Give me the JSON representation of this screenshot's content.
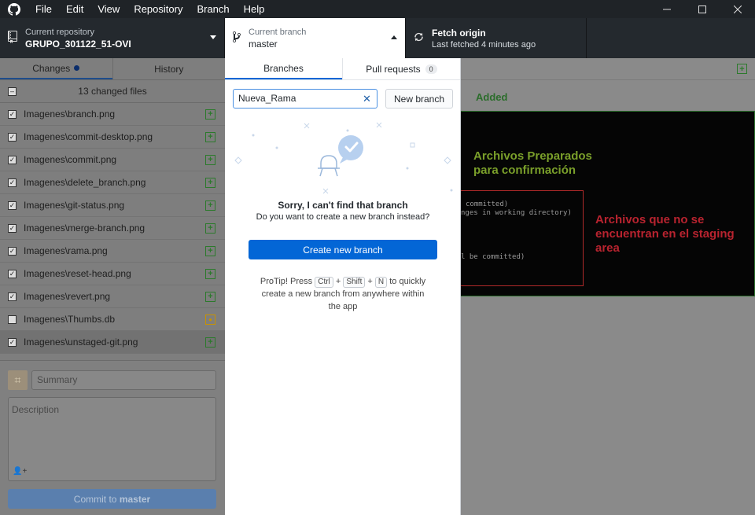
{
  "menu": [
    "File",
    "Edit",
    "View",
    "Repository",
    "Branch",
    "Help"
  ],
  "toolbar": {
    "repo_label": "Current repository",
    "repo_name": "GRUPO_301122_51-OVI",
    "branch_label": "Current branch",
    "branch_name": "master",
    "fetch_title": "Fetch origin",
    "fetch_sub": "Last fetched 4 minutes ago"
  },
  "sidebar": {
    "tab_changes": "Changes",
    "tab_history": "History",
    "changed_count": "13 changed files",
    "files": [
      {
        "name": "Imagenes\\branch.png",
        "checked": true,
        "status": "added"
      },
      {
        "name": "Imagenes\\commit-desktop.png",
        "checked": true,
        "status": "added"
      },
      {
        "name": "Imagenes\\commit.png",
        "checked": true,
        "status": "added"
      },
      {
        "name": "Imagenes\\delete_branch.png",
        "checked": true,
        "status": "added"
      },
      {
        "name": "Imagenes\\git-status.png",
        "checked": true,
        "status": "added"
      },
      {
        "name": "Imagenes\\merge-branch.png",
        "checked": true,
        "status": "added"
      },
      {
        "name": "Imagenes\\rama.png",
        "checked": true,
        "status": "added"
      },
      {
        "name": "Imagenes\\reset-head.png",
        "checked": true,
        "status": "added"
      },
      {
        "name": "Imagenes\\revert.png",
        "checked": true,
        "status": "added"
      },
      {
        "name": "Imagenes\\Thumbs.db",
        "checked": false,
        "status": "modified"
      },
      {
        "name": "Imagenes\\unstaged-git.png",
        "checked": true,
        "status": "added"
      }
    ],
    "summary_placeholder": "Summary",
    "description_placeholder": "Description",
    "commit_prefix": "Commit to ",
    "commit_branch": "master"
  },
  "dropdown": {
    "tab_branches": "Branches",
    "tab_pull_requests": "Pull requests",
    "pull_count": "0",
    "filter_value": "Nueva_Rama",
    "new_branch_label": "New branch",
    "sorry_title": "Sorry, I can't find that branch",
    "sorry_sub": "Do you want to create a new branch instead?",
    "create_label": "Create new branch",
    "protip_prefix": "ProTip! Press",
    "key_ctrl": "Ctrl",
    "key_shift": "Shift",
    "key_n": "N",
    "plus": "+",
    "protip_suffix": "to quickly create a new branch from anywhere within the app"
  },
  "main": {
    "added_label": "Added",
    "prep_line1": "Archivos Preparados",
    "prep_line2": "para confirmación",
    "term1": " committed)",
    "term2": "nges in working directory)",
    "term3": "l be committed)",
    "unstaged_text": "Archivos que no se encuentran en el staging area"
  },
  "colors": {
    "accent": "#0366d6",
    "added": "#2c7a2c",
    "modified": "#c89300",
    "red_annotation": "#b8232f",
    "green_annotation": "#7a9f2a"
  }
}
